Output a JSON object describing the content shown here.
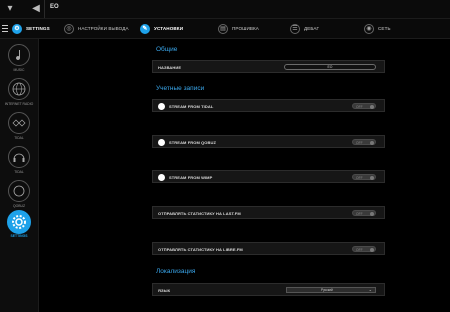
{
  "topbar": {
    "title": "EO"
  },
  "menu": {
    "label": "SETTINGS"
  },
  "tabs": [
    {
      "label": "НАСТРОЙКИ ВЫВОДА"
    },
    {
      "label": "УСТАНОВКИ"
    },
    {
      "label": "ПРОШИВКА"
    },
    {
      "label": "ДЕБАГ"
    },
    {
      "label": "СЕТЬ"
    }
  ],
  "sidebar": {
    "items": [
      {
        "label": "MUSIC"
      },
      {
        "label": "INTERNET RADIO"
      },
      {
        "label": "TIDAL"
      },
      {
        "label": "TIDAL"
      },
      {
        "label": "QOBUZ"
      },
      {
        "label": "SETTINGS"
      }
    ]
  },
  "sections": {
    "general": "Общие",
    "accounts": "Учетные записи",
    "localization": "Локализация"
  },
  "rows": {
    "name": {
      "label": "НАЗВАНИЕ",
      "value": "EO"
    },
    "tidal": {
      "label": "STREAM FROM TIDAL",
      "toggle": "OFF"
    },
    "qobuz": {
      "label": "STREAM FROM QOBUZ",
      "toggle": "OFF"
    },
    "wimp": {
      "label": "STREAM FROM WIMP",
      "toggle": "OFF"
    },
    "lastfm": {
      "label": "ОТПРАВЛЯТЬ СТАТИСТИКУ НА LAST.FM",
      "toggle": "OFF"
    },
    "librefm": {
      "label": "ОТПРАВЛЯТЬ СТАТИСТИКУ НА LIBRE.FM",
      "toggle": "OFF"
    },
    "language": {
      "label": "ЯЗЫК",
      "value": "Русский"
    }
  },
  "colors": {
    "accent": "#1ea2ea",
    "background": "#000000",
    "panel": "#161616"
  }
}
